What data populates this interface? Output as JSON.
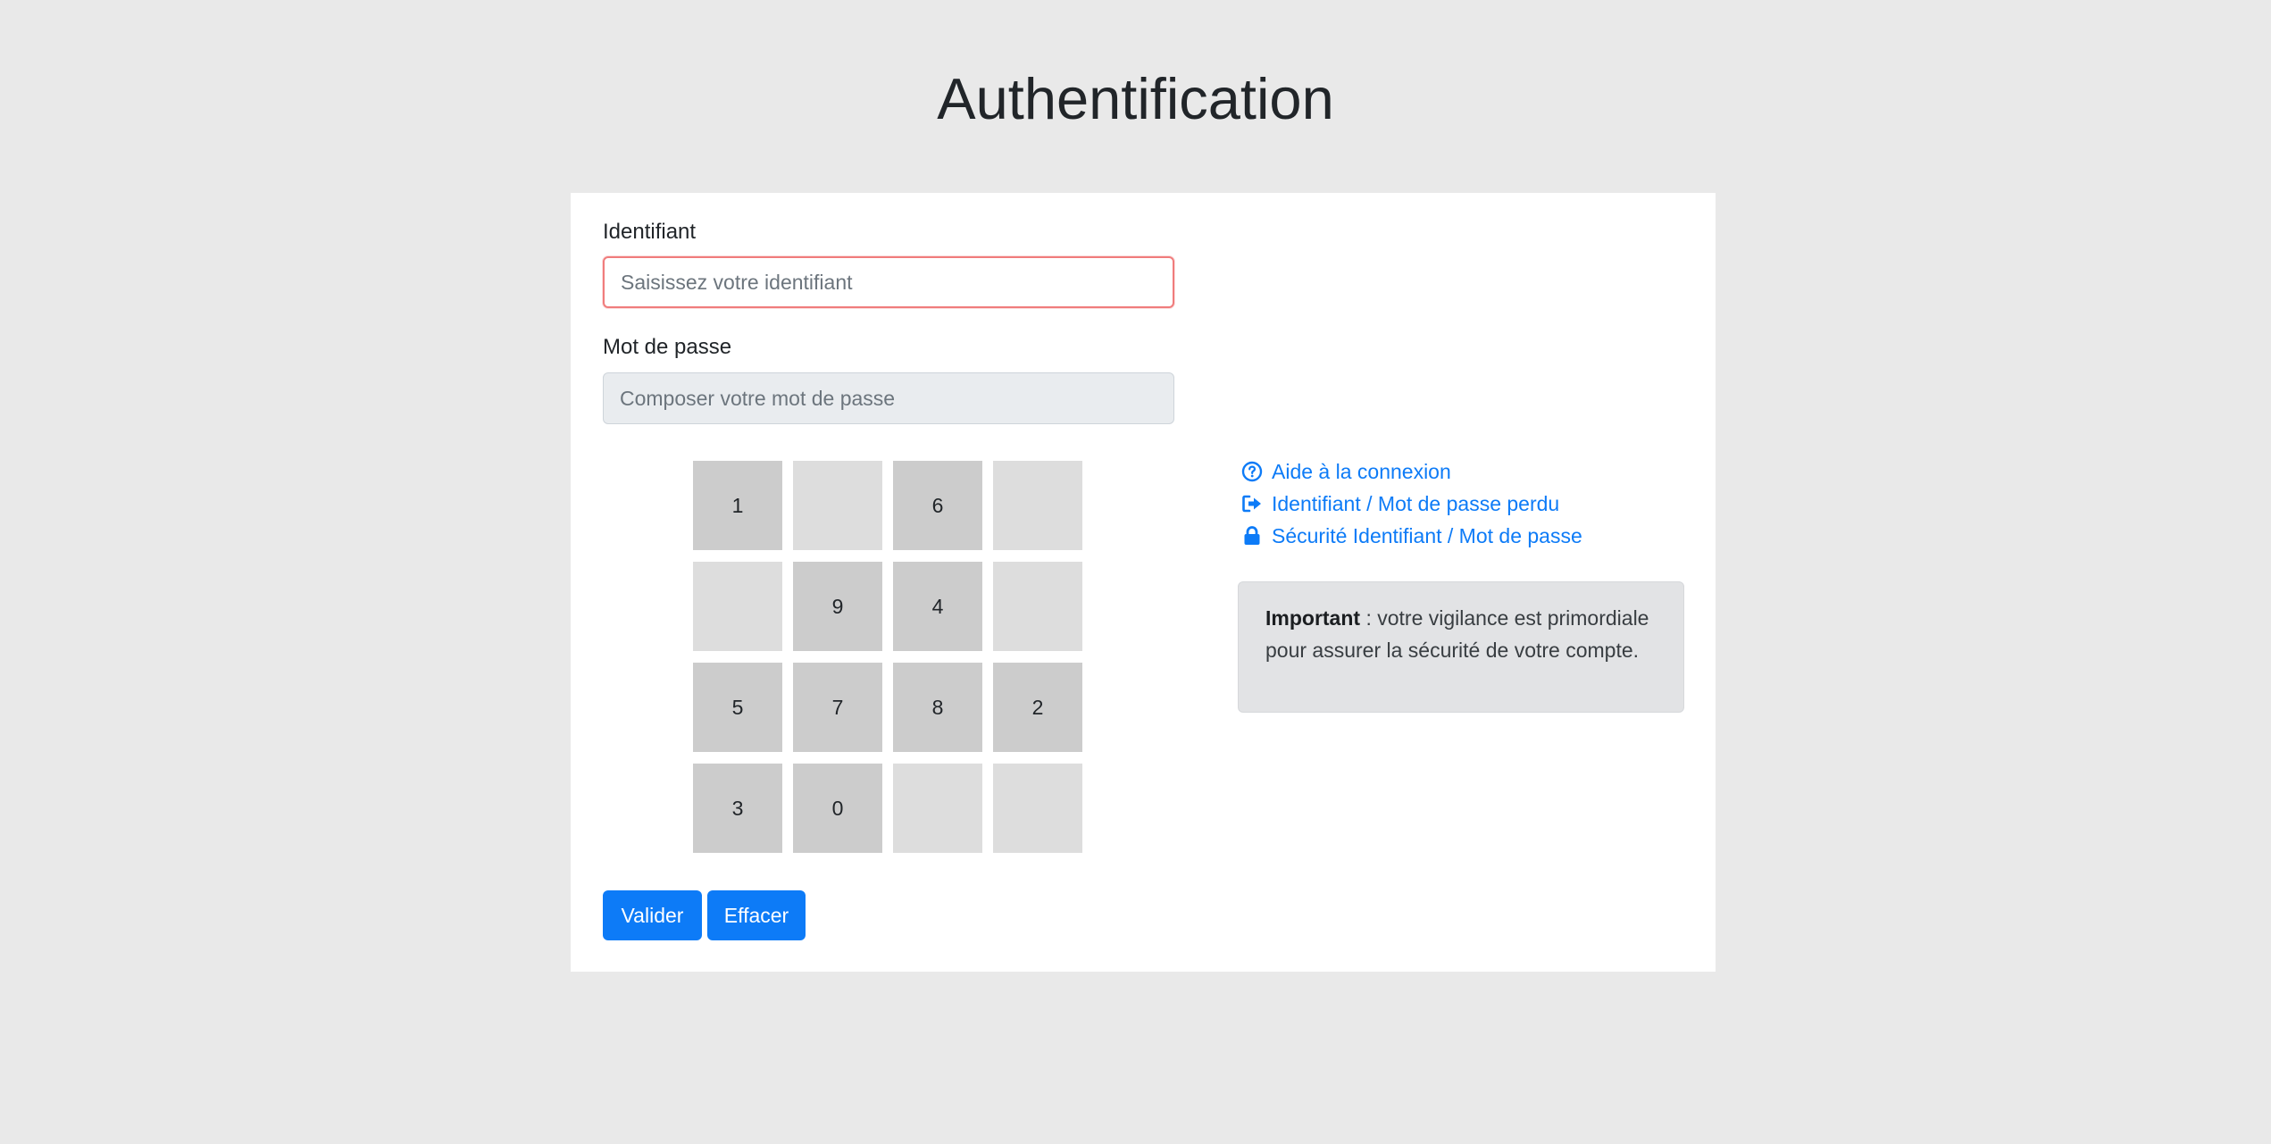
{
  "page": {
    "title": "Authentification"
  },
  "login": {
    "label": "Identifiant",
    "placeholder": "Saisissez votre identifiant",
    "value": ""
  },
  "password": {
    "label": "Mot de passe",
    "placeholder": "Composer votre mot de passe",
    "value": ""
  },
  "keypad": {
    "keys": [
      "1",
      "",
      "6",
      "",
      "",
      "9",
      "4",
      "",
      "5",
      "7",
      "8",
      "2",
      "3",
      "0",
      "",
      ""
    ]
  },
  "buttons": {
    "validate_label": "Valider",
    "clear_label": "Effacer"
  },
  "links": [
    {
      "label": "Aide à la connexion",
      "icon": "question-circle-icon"
    },
    {
      "label": "Identifiant / Mot de passe perdu",
      "icon": "sign-out-icon"
    },
    {
      "label": "Sécurité Identifiant / Mot de passe",
      "icon": "lock-icon"
    }
  ],
  "notice": {
    "strong": "Important",
    "text": " : votre vigilance est primordiale pour assurer la sécurité de votre compte."
  },
  "colors": {
    "background": "#e9e9e9",
    "primary": "#0d7bf7",
    "key_active": "#cccccc",
    "key_empty": "#dddddd",
    "invalid_border": "#f07c7c"
  }
}
